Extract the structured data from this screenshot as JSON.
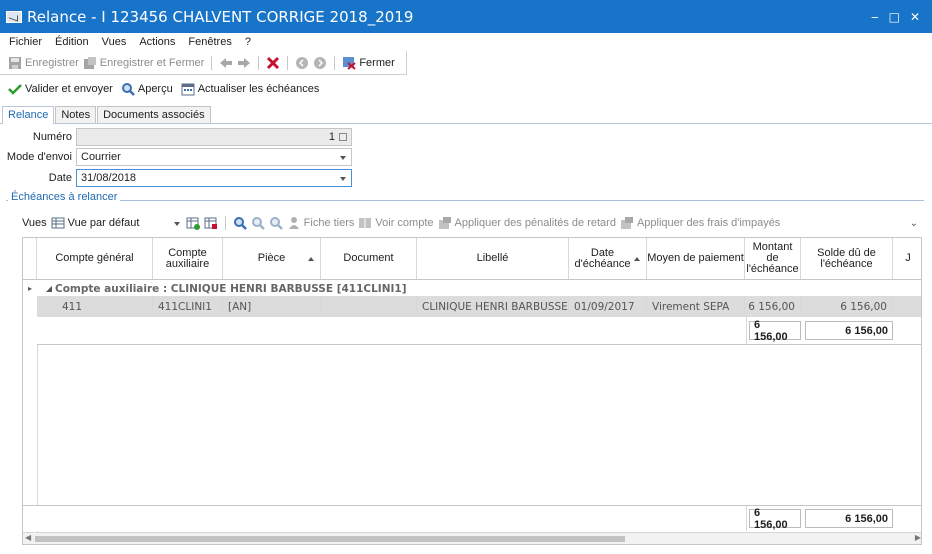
{
  "window": {
    "title": "Relance - I 123456 CHALVENT CORRIGE 2018_2019",
    "min": "‒",
    "max": "□",
    "close": "✕"
  },
  "menu": [
    "Fichier",
    "Édition",
    "Vues",
    "Actions",
    "Fenêtres",
    "?"
  ],
  "toolbar1": {
    "save": "Enregistrer",
    "save_close": "Enregistrer et Fermer",
    "close": "Fermer"
  },
  "toolbar2": {
    "validate": "Valider et envoyer",
    "preview": "Aperçu",
    "refresh": "Actualiser les échéances"
  },
  "tabs": [
    "Relance",
    "Notes",
    "Documents associés"
  ],
  "form": {
    "numero_label": "Numéro",
    "numero_value": "1",
    "mode_label": "Mode d'envoi",
    "mode_value": "Courrier",
    "date_label": "Date",
    "date_value": "31/08/2018"
  },
  "group": {
    "title": "Échéances à relancer"
  },
  "grid_toolbar": {
    "views_label": "Vues",
    "view_value": "Vue par défaut",
    "fiche_tiers": "Fiche tiers",
    "voir_compte": "Voir compte",
    "penalites": "Appliquer des pénalités de retard",
    "frais": "Appliquer des frais d'impayés"
  },
  "columns": [
    "Compte général",
    "Compte auxiliaire",
    "Pièce",
    "Document",
    "Libellé",
    "Date d'échéance",
    "Moyen de paiement",
    "Montant de l'échéance",
    "Solde dû de l'échéance",
    "J"
  ],
  "group_row": "Compte auxiliaire : CLINIQUE HENRI BARBUSSE [411CLINI1]",
  "rows": [
    {
      "compte": "411",
      "aux": "411CLINI1",
      "piece": "[AN]",
      "document": "",
      "libelle": "CLINIQUE HENRI BARBUSSE",
      "date": "01/09/2017",
      "moyen": "Virement SEPA",
      "montant": "6 156,00",
      "solde": "6 156,00"
    }
  ],
  "subtotal": {
    "montant": "6 156,00",
    "solde": "6 156,00"
  },
  "total": {
    "montant": "6 156,00",
    "solde": "6 156,00"
  },
  "colors": {
    "titlebar": "#1874c9",
    "accent": "#1e6ab4",
    "delete": "#c8102e",
    "validate": "#2e9b2e"
  }
}
